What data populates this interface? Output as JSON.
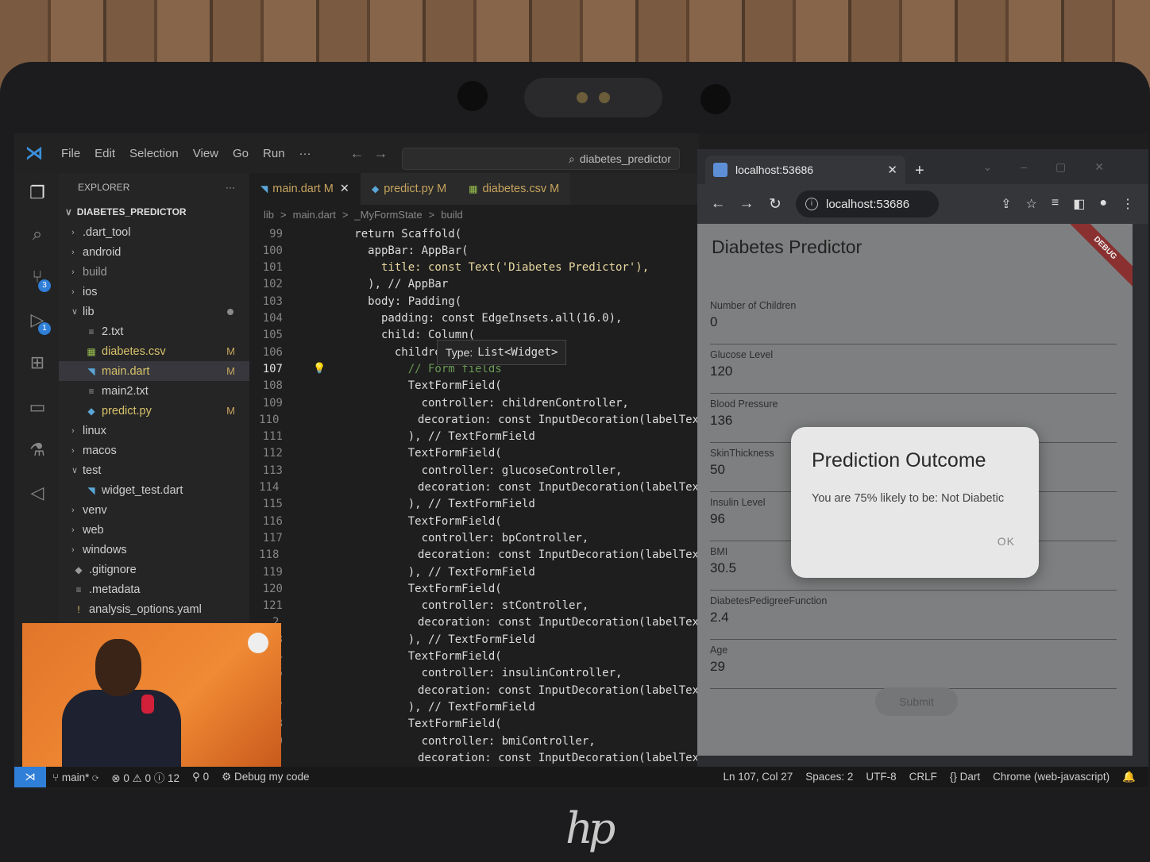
{
  "vscode": {
    "menu": [
      "File",
      "Edit",
      "Selection",
      "View",
      "Go",
      "Run",
      "···"
    ],
    "command_center": "diabetes_predictor",
    "explorer_title": "EXPLORER",
    "explorer_more": "···",
    "root_folder": "DIABETES_PREDICTOR",
    "tree": [
      {
        "label": ".dart_tool",
        "type": "folder",
        "indent": 0
      },
      {
        "label": "android",
        "type": "folder",
        "indent": 0
      },
      {
        "label": "build",
        "type": "folder",
        "indent": 0
      },
      {
        "label": "ios",
        "type": "folder",
        "indent": 0
      },
      {
        "label": "lib",
        "type": "folder-open",
        "indent": 0
      },
      {
        "label": "2.txt",
        "type": "txt",
        "indent": 1
      },
      {
        "label": "diabetes.csv",
        "type": "csv",
        "indent": 1,
        "mark": "M"
      },
      {
        "label": "main.dart",
        "type": "dart",
        "indent": 1,
        "mark": "M"
      },
      {
        "label": "main2.txt",
        "type": "txt",
        "indent": 1
      },
      {
        "label": "predict.py",
        "type": "py",
        "indent": 1,
        "mark": "M"
      },
      {
        "label": "linux",
        "type": "folder",
        "indent": 0
      },
      {
        "label": "macos",
        "type": "folder",
        "indent": 0
      },
      {
        "label": "test",
        "type": "folder-open",
        "indent": 0
      },
      {
        "label": "widget_test.dart",
        "type": "dart",
        "indent": 1
      },
      {
        "label": "venv",
        "type": "folder",
        "indent": 0
      },
      {
        "label": "web",
        "type": "folder",
        "indent": 0
      },
      {
        "label": "windows",
        "type": "folder",
        "indent": 0
      },
      {
        "label": ".gitignore",
        "type": "git",
        "indent": 0
      },
      {
        "label": ".metadata",
        "type": "txt",
        "indent": 0
      },
      {
        "label": "analysis_options.yaml",
        "type": "yaml",
        "indent": 0
      }
    ],
    "tabs": [
      {
        "label": "main.dart M",
        "icon": "dart-icon"
      },
      {
        "label": "predict.py M",
        "icon": "python-icon"
      },
      {
        "label": "diabetes.csv M",
        "icon": "csv-icon"
      }
    ],
    "breadcrumb": [
      "lib",
      ">",
      "main.dart",
      ">",
      "_MyFormState",
      ">",
      "build"
    ],
    "hover_tip": {
      "label": "Type:",
      "type": "List<Widget>"
    },
    "code_lines": [
      {
        "n": "99",
        "text": "          return Scaffold("
      },
      {
        "n": "100",
        "text": "            appBar: AppBar("
      },
      {
        "n": "101",
        "text": "              title: const Text('Diabetes Predictor'),"
      },
      {
        "n": "102",
        "text": "            ), // AppBar"
      },
      {
        "n": "103",
        "text": "            body: Padding("
      },
      {
        "n": "104",
        "text": "              padding: const EdgeInsets.all(16.0),"
      },
      {
        "n": "105",
        "text": "              child: Column("
      },
      {
        "n": "106",
        "text": "                children"
      },
      {
        "n": "107",
        "text": "                  // Form fields"
      },
      {
        "n": "108",
        "text": "                  TextFormField("
      },
      {
        "n": "109",
        "text": "                    controller: childrenController,"
      },
      {
        "n": "110",
        "text": "                    decoration: const InputDecoration(labelTex"
      },
      {
        "n": "111",
        "text": "                  ), // TextFormField"
      },
      {
        "n": "112",
        "text": "                  TextFormField("
      },
      {
        "n": "113",
        "text": "                    controller: glucoseController,"
      },
      {
        "n": "114",
        "text": "                    decoration: const InputDecoration(labelTex"
      },
      {
        "n": "115",
        "text": "                  ), // TextFormField"
      },
      {
        "n": "116",
        "text": "                  TextFormField("
      },
      {
        "n": "117",
        "text": "                    controller: bpController,"
      },
      {
        "n": "118",
        "text": "                    decoration: const InputDecoration(labelTex"
      },
      {
        "n": "119",
        "text": "                  ), // TextFormField"
      },
      {
        "n": "120",
        "text": "                  TextFormField("
      },
      {
        "n": "121",
        "text": "                    controller: stController,"
      },
      {
        "n": "2",
        "text": "                    decoration: const InputDecoration(labelTex"
      },
      {
        "n": "3",
        "text": "                  ), // TextFormField"
      },
      {
        "n": "4",
        "text": "                  TextFormField("
      },
      {
        "n": "5",
        "text": "                    controller: insulinController,"
      },
      {
        "n": "6",
        "text": "                    decoration: const InputDecoration(labelTex"
      },
      {
        "n": "7",
        "text": "                  ), // TextFormField"
      },
      {
        "n": "8",
        "text": "                  TextFormField("
      },
      {
        "n": "9",
        "text": "                    controller: bmiController,"
      },
      {
        "n": "3",
        "text": "                    decoration: const InputDecoration(labelTex"
      }
    ],
    "status": {
      "branch": "main*",
      "problems": "⊗ 0 ⚠ 0 ⓘ 12",
      "ports": "0",
      "debug": "Debug my code",
      "position": "Ln 107, Col 27",
      "spaces": "Spaces: 2",
      "encoding": "UTF-8",
      "eol": "CRLF",
      "language": "{} Dart",
      "target": "Chrome (web-javascript)"
    }
  },
  "browser": {
    "tab_title": "localhost:53686",
    "url": "localhost:53686"
  },
  "app": {
    "title": "Diabetes Predictor",
    "debug_banner": "DEBUG",
    "fields": [
      {
        "label": "Number of Children",
        "value": "0"
      },
      {
        "label": "Glucose Level",
        "value": "120"
      },
      {
        "label": "Blood Pressure",
        "value": "136"
      },
      {
        "label": "SkinThickness",
        "value": "50"
      },
      {
        "label": "Insulin Level",
        "value": "96"
      },
      {
        "label": "BMI",
        "value": "30.5"
      },
      {
        "label": "DiabetesPedigreeFunction",
        "value": "2.4"
      },
      {
        "label": "Age",
        "value": "29"
      }
    ],
    "submit_label": "Submit",
    "dialog": {
      "title": "Prediction Outcome",
      "message": "You are 75% likely to be: Not Diabetic",
      "ok_label": "OK"
    }
  },
  "laptop_brand": "hp"
}
